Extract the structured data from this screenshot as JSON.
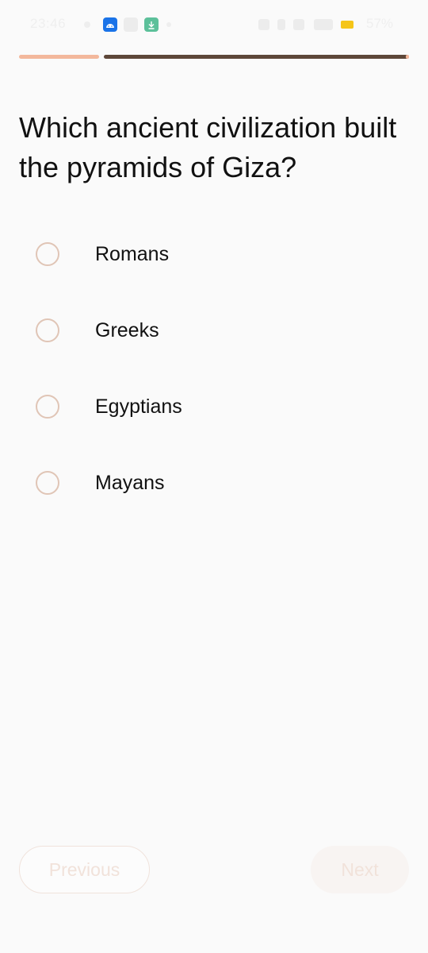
{
  "status_bar": {
    "time": "23:46",
    "battery": "57%",
    "battery_color": "#f5c518",
    "app_icons": [
      "android-icon",
      "gallery-icon",
      "download-icon"
    ]
  },
  "progress": {
    "completed_fraction": 0.21,
    "done_color": "#f3b89c",
    "current_color": "#5e4739"
  },
  "question": {
    "text": "Which ancient civilization built the pyramids of Giza?"
  },
  "options": [
    {
      "label": "Romans",
      "selected": false
    },
    {
      "label": "Greeks",
      "selected": false
    },
    {
      "label": "Egyptians",
      "selected": false
    },
    {
      "label": "Mayans",
      "selected": false
    }
  ],
  "navigation": {
    "previous_label": "Previous",
    "next_label": "Next"
  },
  "colors": {
    "background": "#fafafa",
    "radio_border": "#e0c5b6",
    "text": "#111111",
    "disabled_text": "#f1e2da"
  }
}
